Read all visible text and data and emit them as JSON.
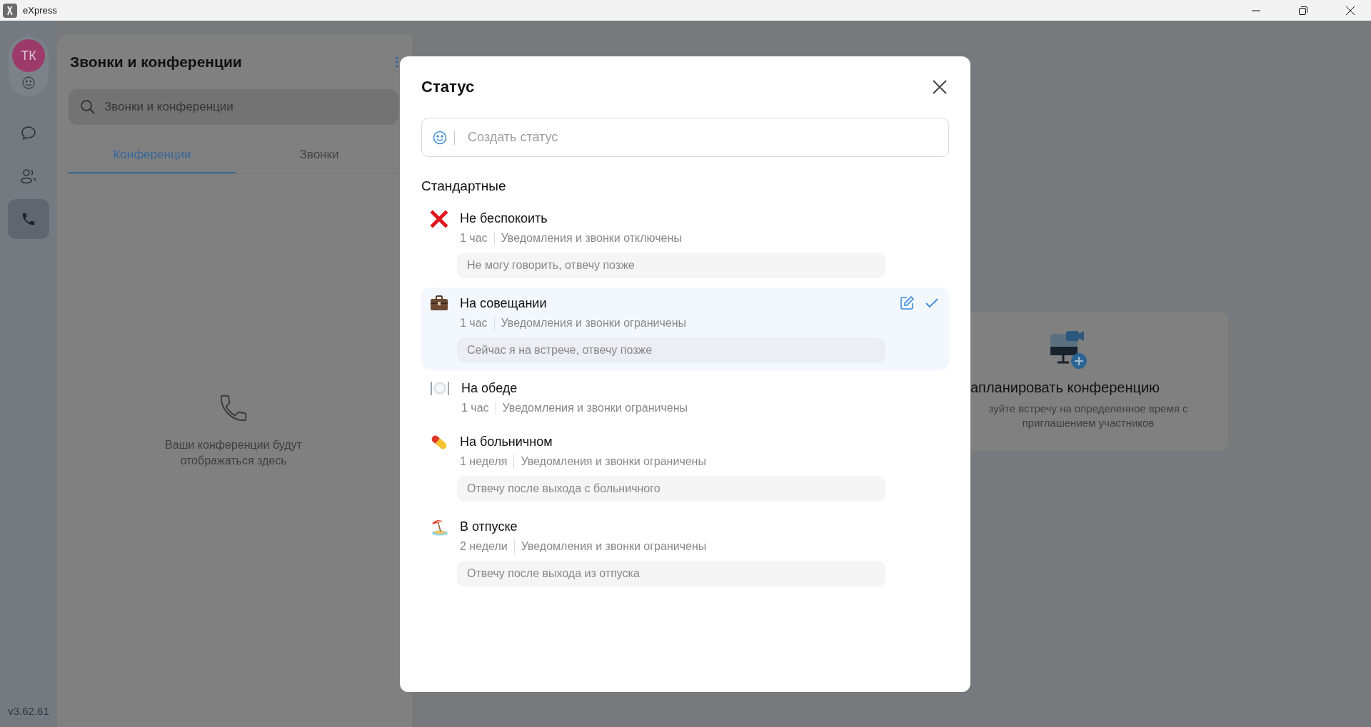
{
  "window": {
    "title": "eXpress"
  },
  "rail": {
    "avatar": "ТК",
    "items": [
      {
        "kind": "chat",
        "selected": false
      },
      {
        "kind": "contacts",
        "selected": false
      },
      {
        "kind": "calls",
        "selected": true
      }
    ],
    "version": "v3.62.61"
  },
  "panel": {
    "title": "Звонки и конференции",
    "search": {
      "placeholder": "Звонки и конференции"
    },
    "tabs": [
      {
        "label": "Конференции",
        "selected": true
      },
      {
        "label": "Звонки",
        "selected": false
      }
    ],
    "empty_text": "Ваши конференции будут отображаться здесь"
  },
  "schedule_card": {
    "title": "апланировать конференцию",
    "text": "зуйте встречу на определенное время с приглашением участников"
  },
  "dialog": {
    "title": "Статус",
    "input": {
      "placeholder": "Создать статус"
    },
    "section": "Стандартные",
    "statuses": [
      {
        "kind": "dnd",
        "name": "Не беспокоить",
        "duration": "1 час",
        "effect": "Уведомления и звонки отключены",
        "message": "Не могу говорить, отвечу позже",
        "selected": false
      },
      {
        "kind": "meeting",
        "name": "На совещании",
        "duration": "1 час",
        "effect": "Уведомления и звонки ограничены",
        "message": "Сейчас я на встрече, отвечу позже",
        "selected": true
      },
      {
        "kind": "lunch",
        "name": "На обеде",
        "duration": "1 час",
        "effect": "Уведомления и звонки ограничены",
        "selected": false
      },
      {
        "kind": "sick",
        "name": "На больничном",
        "duration": "1 неделя",
        "effect": "Уведомления и звонки ограничены",
        "message": "Отвечу после выхода с больничного",
        "selected": false
      },
      {
        "kind": "vacation",
        "name": "В отпуске",
        "duration": "2 недели",
        "effect": "Уведомления и звонки ограничены",
        "message": "Отвечу после выхода из отпуска",
        "selected": false
      }
    ]
  }
}
